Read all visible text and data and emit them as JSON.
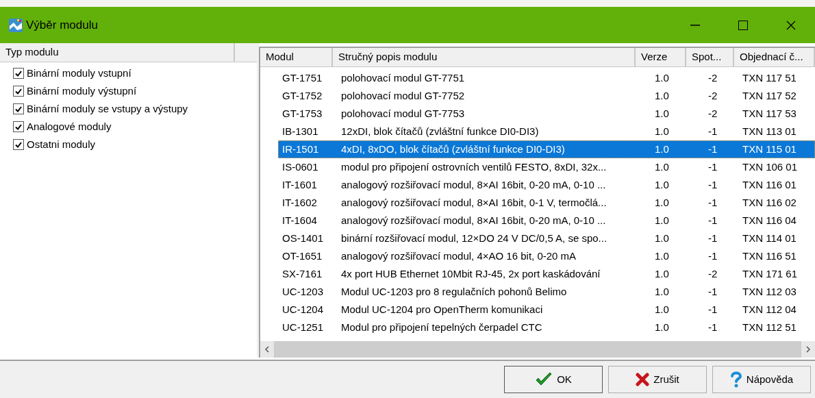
{
  "window": {
    "title": "Výběr modulu"
  },
  "module_types": {
    "header": "Typ modulu",
    "items": [
      {
        "label": "Binární moduly vstupní",
        "checked": true
      },
      {
        "label": "Binární moduly výstupní",
        "checked": true
      },
      {
        "label": "Binární moduly se vstupy a výstupy",
        "checked": true
      },
      {
        "label": "Analogové moduly",
        "checked": true
      },
      {
        "label": "Ostatni moduly",
        "checked": true
      }
    ]
  },
  "table": {
    "columns": [
      "Modul",
      "Stručný popis modulu",
      "Verze",
      "Spot...",
      "Objednací č..."
    ],
    "rows": [
      {
        "cells": [
          "GT-1751",
          "polohovací modul GT-7751",
          "1.0",
          "-2",
          "TXN 117 51"
        ],
        "selected": false
      },
      {
        "cells": [
          "GT-1752",
          "polohovací modul GT-7752",
          "1.0",
          "-2",
          "TXN 117 52"
        ],
        "selected": false
      },
      {
        "cells": [
          "GT-1753",
          "polohovací modul GT-7753",
          "1.0",
          "-2",
          "TXN 117 53"
        ],
        "selected": false
      },
      {
        "cells": [
          "IB-1301",
          "12xDI, blok čítačů (zvláštní funkce DI0-DI3)",
          "1.0",
          "-1",
          "TXN 113 01"
        ],
        "selected": false
      },
      {
        "cells": [
          "IR-1501",
          "4xDI, 8xDO, blok čítačů (zvláštní funkce DI0-DI3)",
          "1.0",
          "-1",
          "TXN 115 01"
        ],
        "selected": true
      },
      {
        "cells": [
          "IS-0601",
          "modul pro připojení ostrovních ventilů FESTO, 8xDI, 32x...",
          "1.0",
          "-1",
          "TXN 106 01"
        ],
        "selected": false
      },
      {
        "cells": [
          "IT-1601",
          "analogový rozšiřovací modul, 8×AI 16bit, 0-20 mA, 0-10 ...",
          "1.0",
          "-1",
          "TXN 116 01"
        ],
        "selected": false
      },
      {
        "cells": [
          "IT-1602",
          "analogový rozšiřovací modul, 8×AI 16bit, 0-1 V, termočlá...",
          "1.0",
          "-1",
          "TXN 116 02"
        ],
        "selected": false
      },
      {
        "cells": [
          "IT-1604",
          "analogový rozšiřovací modul, 8×AI 16bit, 0-20 mA, 0-10 ...",
          "1.0",
          "-1",
          "TXN 116 04"
        ],
        "selected": false
      },
      {
        "cells": [
          "OS-1401",
          "binární rozšiřovací modul, 12×DO 24 V DC/0,5 A, se spo...",
          "1.0",
          "-1",
          "TXN 114 01"
        ],
        "selected": false
      },
      {
        "cells": [
          "OT-1651",
          "analogový rozšiřovací modul, 4×AO 16 bit, 0-20 mA",
          "1.0",
          "-1",
          "TXN 116 51"
        ],
        "selected": false
      },
      {
        "cells": [
          "SX-7161",
          "4x port HUB Ethernet 10Mbit RJ-45, 2x port kaskádování",
          "1.0",
          "-2",
          "TXN 171 61"
        ],
        "selected": false
      },
      {
        "cells": [
          "UC-1203",
          "Modul UC-1203 pro 8 regulačních pohonů Belimo",
          "1.0",
          "-1",
          "TXN 112 03"
        ],
        "selected": false
      },
      {
        "cells": [
          "UC-1204",
          "Modul UC-1204 pro OpenTherm komunikaci",
          "1.0",
          "-1",
          "TXN 112 04"
        ],
        "selected": false
      },
      {
        "cells": [
          "UC-1251",
          "Modul pro připojení tepelných čerpadel CTC",
          "1.0",
          "-1",
          "TXN 112 51"
        ],
        "selected": false
      }
    ]
  },
  "buttons": [
    {
      "kind": "ok",
      "label": "OK"
    },
    {
      "kind": "cancel",
      "label": "Zrušit"
    },
    {
      "kind": "help",
      "label": "Nápověda"
    }
  ]
}
